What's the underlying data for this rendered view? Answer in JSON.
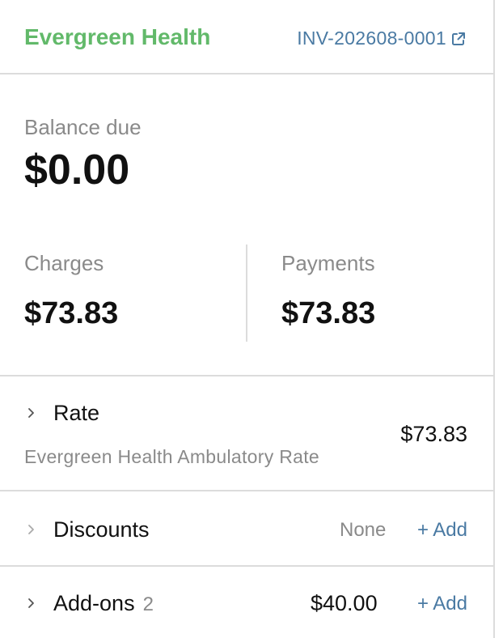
{
  "header": {
    "brand": "Evergreen Health",
    "invoice_number": "INV-202608-0001"
  },
  "summary": {
    "balance_label": "Balance due",
    "balance_value": "$0.00",
    "charges_label": "Charges",
    "charges_value": "$73.83",
    "payments_label": "Payments",
    "payments_value": "$73.83"
  },
  "rows": {
    "rate": {
      "title": "Rate",
      "subtitle": "Evergreen Health Ambulatory Rate",
      "amount": "$73.83"
    },
    "discounts": {
      "title": "Discounts",
      "status": "None",
      "add_label": "+ Add"
    },
    "addons": {
      "title": "Add-ons",
      "count": "2",
      "amount": "$40.00",
      "add_label": "+ Add"
    }
  },
  "colors": {
    "brand": "#62b96a",
    "link": "#4a7aa3",
    "muted": "#8a8a8a",
    "border": "#dcdcdc"
  },
  "icons": {
    "invoice_link": "external-link-icon",
    "row_toggle": "chevron-right-icon"
  }
}
